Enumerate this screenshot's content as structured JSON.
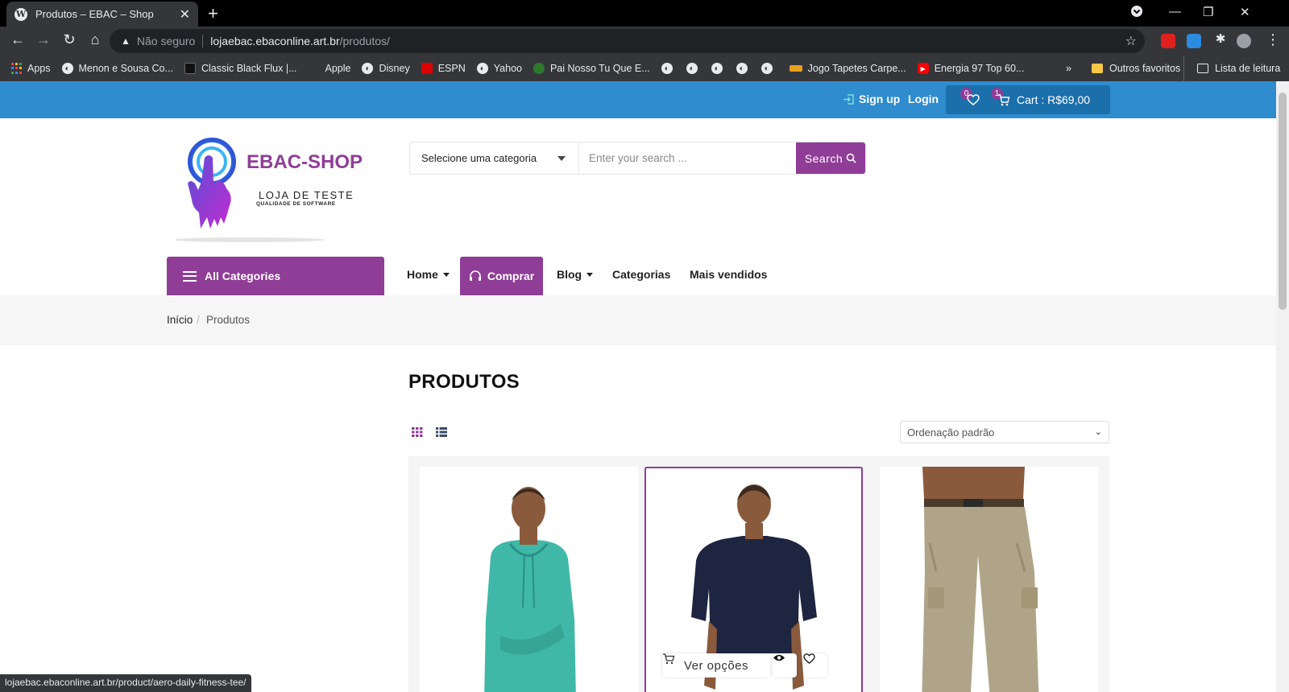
{
  "browser": {
    "tab_title": "Produtos – EBAC – Shop",
    "address": {
      "security": "Não seguro",
      "host": "lojaebac.ebaconline.art.br",
      "path": "/produtos/"
    },
    "bookmarks": [
      "Apps",
      "Menon e Sousa Co...",
      "Classic Black Flux |...",
      "Apple",
      "Disney",
      "ESPN",
      "Yahoo",
      "Pai Nosso Tu Que E...",
      "Jogo Tapetes Carpe...",
      "Energia 97 Top 60..."
    ],
    "bookmarks_more": "»",
    "other_favorites": "Outros favoritos",
    "reading_list": "Lista de leitura",
    "status_url": "lojaebac.ebaconline.art.br/product/aero-daily-fitness-tee/"
  },
  "topbar": {
    "signup": "Sign up",
    "login": "Login",
    "wishlist_count": "0",
    "cart_count": "1",
    "cart_label": "Cart : R$69,00"
  },
  "brand": {
    "name": "EBAC-SHOP",
    "subtitle": "LOJA DE TESTE",
    "tagline": "QUALIDADE DE SOFTWARE"
  },
  "search": {
    "category_label": "Selecione uma categoria",
    "placeholder": "Enter your search ...",
    "button": "Search"
  },
  "nav": {
    "all_categories": "All Categories",
    "home": "Home",
    "comprar": "Comprar",
    "blog": "Blog",
    "categorias": "Categorias",
    "mais_vendidos": "Mais vendidos"
  },
  "breadcrumb": {
    "home": "Início",
    "sep": "/",
    "current": "Produtos"
  },
  "products_page": {
    "title": "PRODUTOS",
    "sort_label": "Ordenação padrão"
  },
  "product_card": {
    "ver_opcoes": "Ver opções"
  },
  "colors": {
    "brand": "#8f3d97",
    "topbar": "#2e8ccf",
    "cart": "#1b6fab"
  }
}
